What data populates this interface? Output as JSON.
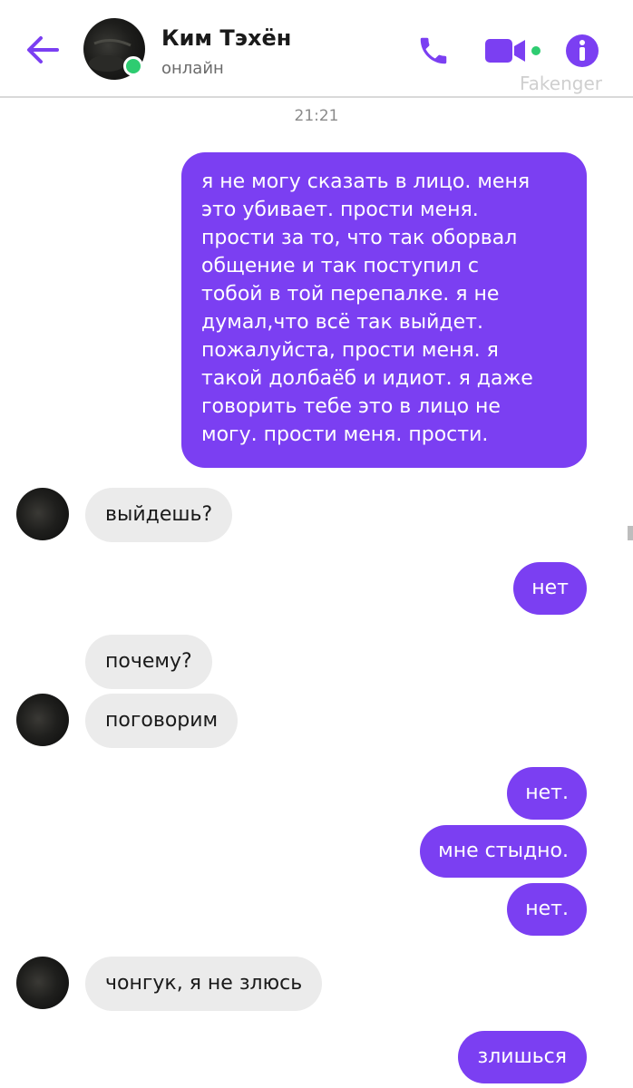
{
  "header": {
    "contact_name": "Ким Тэхён",
    "status": "онлайн",
    "watermark": "Fakenger",
    "accent_color": "#7b3ff2",
    "online_color": "#2ecc71",
    "icons": [
      "back-arrow-icon",
      "phone-icon",
      "video-camera-icon",
      "info-icon"
    ]
  },
  "chat": {
    "timestamp": "21:21",
    "messages": [
      {
        "direction": "out",
        "lines": [
          "я не могу сказать в лицо. меня",
          "это убивает. прости меня.",
          "прости за то, что так оборвал",
          "общение и так поступил с",
          "тобой в той перепалке. я не",
          "думал,что всё так выйдет.",
          "пожалуйста, прости меня. я",
          "такой долбаёб и идиот. я даже",
          "говорить тебе это в лицо не",
          "могу. прости меня. прости."
        ]
      },
      {
        "direction": "in",
        "text": "выйдешь?"
      },
      {
        "direction": "out",
        "text": "нет"
      },
      {
        "direction": "in",
        "text": "почему?"
      },
      {
        "direction": "in",
        "text": "поговорим"
      },
      {
        "direction": "out",
        "text": "нет."
      },
      {
        "direction": "out",
        "text": "мне стыдно."
      },
      {
        "direction": "out",
        "text": "нет."
      },
      {
        "direction": "in",
        "text": "чонгук, я не злюсь"
      },
      {
        "direction": "out",
        "text": "злишься"
      }
    ]
  }
}
